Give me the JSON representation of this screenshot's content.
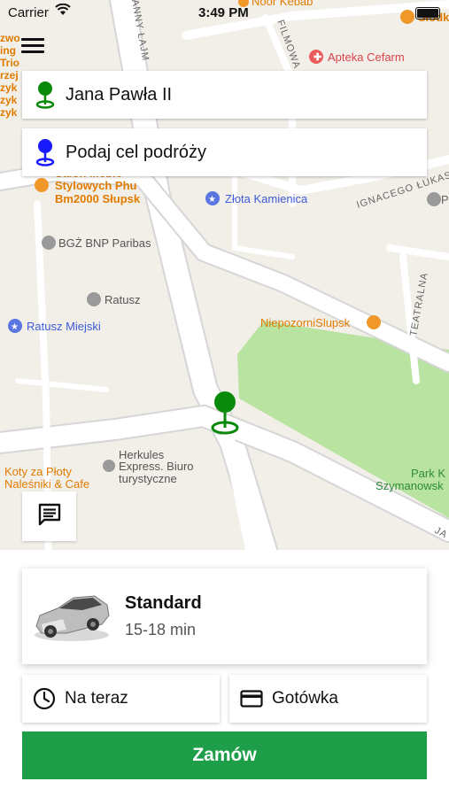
{
  "status_bar": {
    "carrier": "Carrier",
    "time": "3:49 PM"
  },
  "map": {
    "street_labels": [
      "ANNY ŁAJM",
      "FILMOWA",
      "IGNACEGO ŁUKASIE",
      "TEATRALNA",
      "JA"
    ],
    "pois": {
      "noor_kebab": "Noor Kebab",
      "apteka": "Apteka Cefarm",
      "slodki": "Słodk",
      "zlota": "Złota Kamienica",
      "stylowych_1": "Stylowych Phu",
      "stylowych_2": "Bm2000 Słupsk",
      "salon": "Salon Meble",
      "bgz": "BGŻ BNP Paribas",
      "ratusz": "Ratusz",
      "ratusz_miejski": "Ratusz Miejski",
      "niepozorni": "NiepozorniSlupsk",
      "herkules_1": "Herkules",
      "herkules_2": "Express. Biuro",
      "herkules_3": "turystyczne",
      "koty_1": "Koty za Płoty",
      "koty_2": "Naleśniki & Cafe",
      "park_1": "Park K",
      "park_2": "Szymanowsk",
      "edge_p": "P",
      "left_edge": [
        "zwo",
        "ing",
        "Trio",
        "rzej",
        "zyk",
        "zyk",
        "zyk"
      ]
    }
  },
  "route": {
    "pickup": "Jana Pawła II",
    "destination_placeholder": "Podaj cel podróży"
  },
  "ride": {
    "class_name": "Standard",
    "eta": "15-18 min"
  },
  "options": {
    "time_label": "Na teraz",
    "payment_label": "Gotówka"
  },
  "order_button": "Zamów",
  "colors": {
    "accent_green": "#1e9e49",
    "pin_green": "#0a8a0a",
    "pin_blue": "#1a1aff"
  },
  "icons": [
    "wifi-icon",
    "battery-icon",
    "menu-icon",
    "pickup-pin-icon",
    "destination-pin-icon",
    "chat-icon",
    "car-icon",
    "clock-icon",
    "card-icon"
  ]
}
